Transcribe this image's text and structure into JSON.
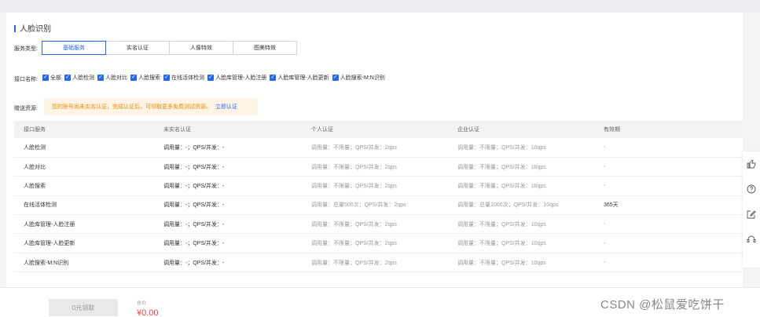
{
  "page": {
    "title": "人脸识别"
  },
  "service_type": {
    "label": "服务类型:",
    "tabs": [
      "基础服务",
      "实名认证",
      "人像特效",
      "图美特效"
    ],
    "active_index": 0
  },
  "interface": {
    "label": "接口名称:",
    "items": [
      "全部",
      "人脸检测",
      "人脸对比",
      "人脸搜索",
      "在线活体检测",
      "人脸库管理-人脸注册",
      "人脸库管理-人脸更新",
      "人脸搜索-M:N识别"
    ]
  },
  "gift": {
    "label": "赠送资源:",
    "notice": "您的账号尚未实名认证，完成认证后，可领取更多免费测试资源。",
    "link": "立即认证"
  },
  "table": {
    "headers": [
      "接口服务",
      "未实名认证",
      "个人认证",
      "企业认证",
      "有效期"
    ],
    "rows": [
      [
        "人脸检测",
        "调用量：-；QPS/并发：-",
        "调用量：不限量；QPS/并发：2qps",
        "调用量：不限量；QPS/并发：10qps",
        "-"
      ],
      [
        "人脸对比",
        "调用量：-；QPS/并发：-",
        "调用量：不限量；QPS/并发：2qps",
        "调用量：不限量；QPS/并发：10qps",
        "-"
      ],
      [
        "人脸搜索",
        "调用量：-；QPS/并发：-",
        "调用量：不限量；QPS/并发：2qps",
        "调用量：不限量；QPS/并发：10qps",
        "-"
      ],
      [
        "在线活体检测",
        "调用量：-；QPS/并发：-",
        "调用量：总量500次；QPS/并发：2qps",
        "调用量：总量1000次；QPS/并发：10qps",
        "365天"
      ],
      [
        "人脸库管理-人脸注册",
        "调用量：-；QPS/并发：-",
        "调用量：不限量；QPS/并发：2qps",
        "调用量：不限量；QPS/并发：10qps",
        "-"
      ],
      [
        "人脸库管理-人脸更新",
        "调用量：-；QPS/并发：-",
        "调用量：不限量；QPS/并发：2qps",
        "调用量：不限量；QPS/并发：10qps",
        "-"
      ],
      [
        "人脸搜索-M:N识别",
        "调用量：-；QPS/并发：-",
        "调用量：不限量；QPS/并发：2qps",
        "调用量：不限量；QPS/并发：10qps",
        "-"
      ]
    ]
  },
  "sidebar": {
    "icons": [
      "thumbs-up-icon",
      "help-icon",
      "edit-icon",
      "headset-icon"
    ]
  },
  "footer": {
    "button": "0元领取",
    "total_label": "总价:",
    "total_value": "¥0.00"
  },
  "watermark": "CSDN @松鼠爱吃饼干",
  "colors": {
    "accent": "#2468f2",
    "warning": "#f38900",
    "price": "#f33e3e"
  }
}
